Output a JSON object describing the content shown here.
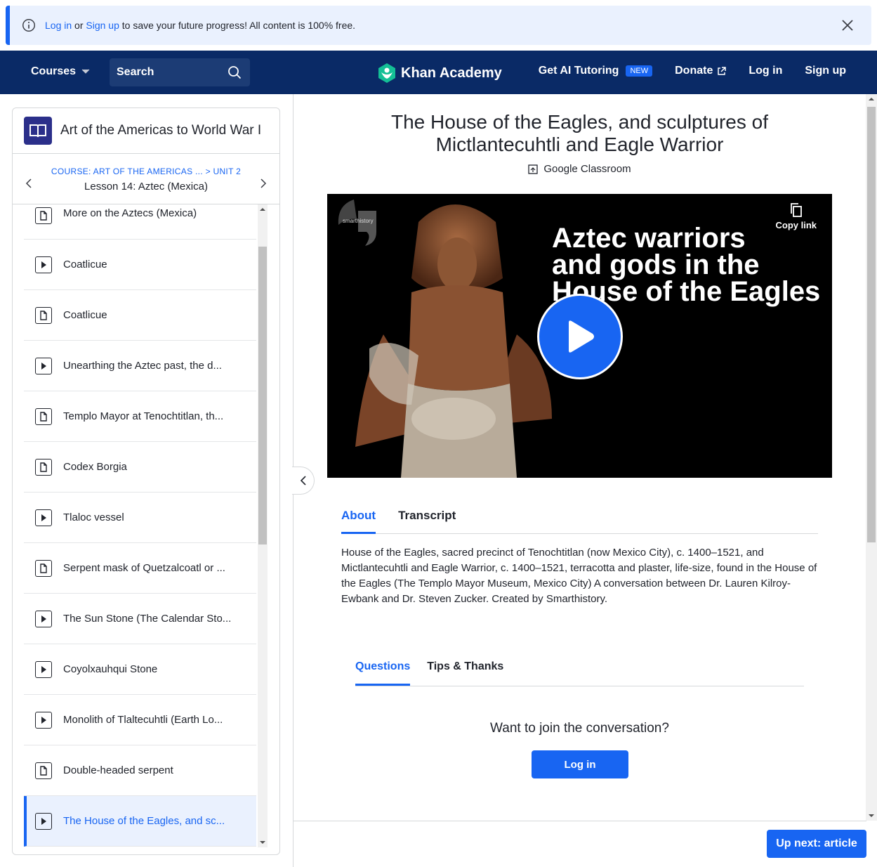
{
  "banner": {
    "login": "Log in",
    "or": "or",
    "signup": "Sign up",
    "rest": "to save your future progress! All content is 100% free."
  },
  "header": {
    "courses": "Courses",
    "search_placeholder": "Search",
    "logo": "Khan Academy",
    "ai_tutoring": "Get AI Tutoring",
    "new_badge": "NEW",
    "donate": "Donate",
    "login": "Log in",
    "signup": "Sign up"
  },
  "sidebar": {
    "course_title": "Art of the Americas to World War I",
    "breadcrumb_course": "COURSE: ART OF THE AMERICAS ...",
    "breadcrumb_unit": "> UNIT 2",
    "lesson": "Lesson 14: Aztec (Mexica)",
    "items": [
      {
        "label": "More on the Aztecs (Mexica)",
        "type": "article"
      },
      {
        "label": "Coatlicue",
        "type": "video"
      },
      {
        "label": "Coatlicue",
        "type": "article"
      },
      {
        "label": "Unearthing the Aztec past, the d...",
        "type": "video"
      },
      {
        "label": "Templo Mayor at Tenochtitlan, th...",
        "type": "article"
      },
      {
        "label": "Codex Borgia",
        "type": "article"
      },
      {
        "label": "Tlaloc vessel",
        "type": "video"
      },
      {
        "label": "Serpent mask of Quetzalcoatl or ...",
        "type": "article"
      },
      {
        "label": "The Sun Stone (The Calendar Sto...",
        "type": "video"
      },
      {
        "label": "Coyolxauhqui Stone",
        "type": "video"
      },
      {
        "label": "Monolith of Tlaltecuhtli (Earth Lo...",
        "type": "video"
      },
      {
        "label": "Double-headed serpent",
        "type": "article"
      },
      {
        "label": "The House of the Eagles, and sc...",
        "type": "video",
        "active": true
      }
    ]
  },
  "main": {
    "title_line1": "The House of the Eagles, and sculptures of",
    "title_line2": "Mictlantecuhtli and Eagle Warrior",
    "google_classroom": "Google Classroom",
    "video": {
      "brand": "smarthistory",
      "line1": "Aztec warriors",
      "line2": "and gods in the",
      "line3": "House of the Eagles",
      "copy_link": "Copy link"
    },
    "tabs": [
      "About",
      "Transcript"
    ],
    "about": "House of the Eagles, sacred precinct of Tenochtitlan (now Mexico City), c. 1400–1521, and Mictlantecuhtli and Eagle Warrior, c. 1400–1521, terracotta and plaster, life-size, found in the House of the Eagles (The Templo Mayor Museum, Mexico City) A conversation between Dr. Lauren Kilroy-Ewbank and Dr. Steven Zucker. Created by Smarthistory.",
    "discussion_tabs": [
      "Questions",
      "Tips & Thanks"
    ],
    "join_prompt": "Want to join the conversation?",
    "login_button": "Log in",
    "up_next": "Up next: article"
  },
  "colors": {
    "accent": "#1865f2",
    "header_bg": "#0a2a66",
    "banner_bg": "#eaf1fe"
  }
}
